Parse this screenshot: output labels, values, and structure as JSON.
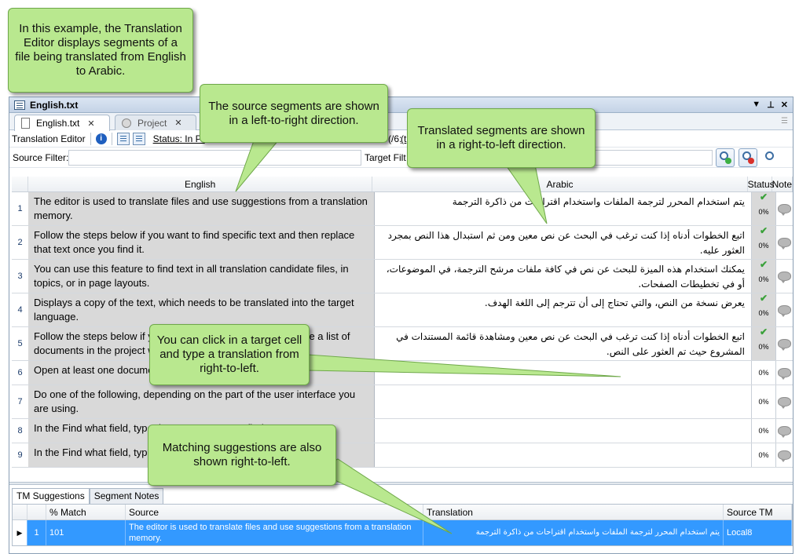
{
  "callouts": {
    "intro": "In this example, the Translation Editor displays segments of a file being translated from English to Arabic.",
    "source": "The source segments are shown in a left-to-right direction.",
    "translated": "Translated segments are shown in a right-to-left direction.",
    "click": "You can click in a target cell and type a translation from right-to-left.",
    "matching": "Matching suggestions are also shown right-to-left."
  },
  "window": {
    "title": "English.txt",
    "controls": [
      "▼",
      "⊥",
      "✕"
    ]
  },
  "tabs": [
    {
      "label": "English.txt",
      "close": "✕"
    },
    {
      "label": "Project",
      "close": "✕"
    }
  ],
  "toolbar": {
    "label": "Translation Editor",
    "status": "Status: In Pr",
    "partial1": "(/6:",
    "partial2": "(t"
  },
  "filters": {
    "source_label": "Source Filter:",
    "target_label": "Target Filt"
  },
  "grid": {
    "headers": {
      "source": "English",
      "target": "Arabic",
      "status": "Status",
      "note": "Note"
    },
    "rows": [
      {
        "num": "1",
        "src": "The editor is used to translate files and use suggestions from a translation memory.",
        "tgt": "يتم استخدام المحرر لترجمة الملفات واستخدام اقتراحات من ذاكرة الترجمة",
        "check": "✔",
        "pct": "0%"
      },
      {
        "num": "2",
        "src": "Follow the steps below if you want to find specific text and then replace that text once you find it.",
        "tgt": "اتبع الخطوات أدناه إذا كنت ترغب في البحث عن نص معين ومن ثم استبدال هذا النص بمجرد العثور عليه.",
        "check": "✔",
        "pct": "0%"
      },
      {
        "num": "3",
        "src": "You can use this feature to find text in all translation candidate files, in topics, or in page layouts.",
        "tgt": "يمكنك استخدام هذه الميزة للبحث عن نص في كافة ملفات مرشح الترجمة، في الموضوعات، أو في تخطيطات الصفحات.",
        "check": "✔",
        "pct": "0%"
      },
      {
        "num": "4",
        "src": "Displays a copy of the text, which needs to be translated into the target language.",
        "tgt": "يعرض نسخة من النص، والتي تحتاج إلى أن تترجم إلى اللغة الهدف.",
        "check": "✔",
        "pct": "0%"
      },
      {
        "num": "5",
        "src": "Follow the steps below if you want to find specific text and see a list of documents in the project where it is found.",
        "tgt": "اتبع الخطوات أدناه إذا كنت ترغب في البحث عن نص معين ومشاهدة قائمة المستندات في المشروع حيث تم العثور على النص.",
        "check": "✔",
        "pct": "0%"
      },
      {
        "num": "6",
        "src": "Open at least one document.",
        "tgt": "",
        "check": "",
        "pct": "0%"
      },
      {
        "num": "7",
        "src": "Do one of the following, depending on the part of the user interface you are using.",
        "tgt": "",
        "check": "",
        "pct": "0%"
      },
      {
        "num": "8",
        "src": "In the Find what field, type the text you want to find.",
        "tgt": "",
        "check": "",
        "pct": "0%"
      },
      {
        "num": "9",
        "src": "In the Find what field, type the text you want to find.",
        "tgt": "",
        "check": "",
        "pct": "0%"
      }
    ]
  },
  "bottom_tabs": [
    "TM Suggestions",
    "Segment Notes"
  ],
  "tm": {
    "headers": {
      "match": "% Match",
      "source": "Source",
      "translation": "Translation",
      "source_tm": "Source TM"
    },
    "row": {
      "ptr": "▶",
      "num": "1",
      "match": "101",
      "source": "The editor is used to translate files and use suggestions from a translation memory.",
      "translation": "يتم استخدام المحرر لترجمة الملفات واستخدام اقتراحات من ذاكرة الترجمة",
      "source_tm": "Local8"
    }
  }
}
